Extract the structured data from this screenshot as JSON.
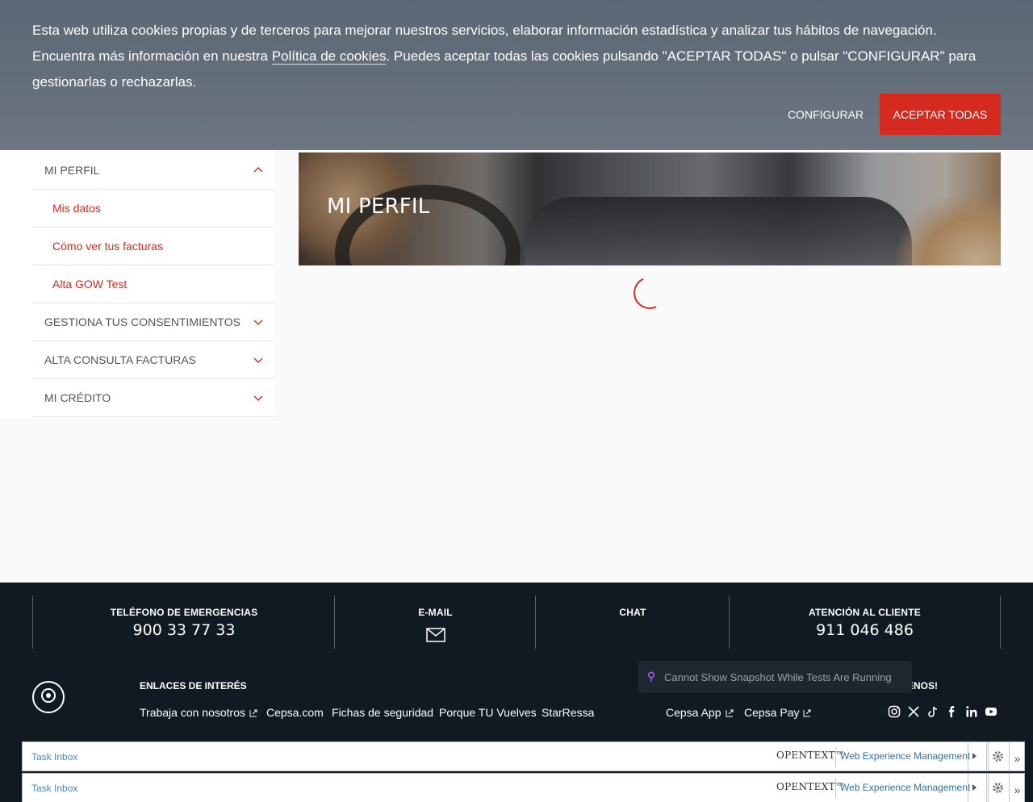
{
  "cookie_banner": {
    "text_before": "Esta web utiliza cookies propias y de terceros para mejorar nuestros servicios, elaborar información estadística y analizar tus hábitos de navegación. Encuentra más información en nuestra ",
    "policy_link": "Política de cookies",
    "text_after": ". Puedes aceptar todas las cookies pulsando \"ACEPTAR TODAS\" o pulsar \"CONFIGURAR\" para gestionarlas o rechazarlas.",
    "configure_label": "CONFIGURAR",
    "accept_label": "ACEPTAR TODAS",
    "accent_color": "#d42a1f"
  },
  "sidebar": {
    "items": [
      {
        "label": "MI PERFIL",
        "type": "parent",
        "expanded": true
      },
      {
        "label": "Mis datos",
        "type": "child"
      },
      {
        "label": "Cómo ver tus facturas",
        "type": "child"
      },
      {
        "label": "Alta GOW Test",
        "type": "child"
      },
      {
        "label": "GESTIONA TUS CONSENTIMIENTOS",
        "type": "parent",
        "expanded": false
      },
      {
        "label": "ALTA CONSULTA FACTURAS",
        "type": "parent",
        "expanded": false
      },
      {
        "label": "MI CRÉDITO",
        "type": "parent",
        "expanded": false
      }
    ]
  },
  "hero": {
    "title": "MI PERFIL"
  },
  "footer": {
    "contacts": [
      {
        "label": "TELÉFONO DE EMERGENCIAS",
        "value": "900 33 77 33"
      },
      {
        "label": "E-MAIL",
        "icon": "mail-icon"
      },
      {
        "label": "CHAT"
      },
      {
        "label": "ATENCIÓN AL CLIENTE",
        "value": "911 046 486"
      }
    ],
    "links_title": "ENLACES DE INTERÉS",
    "links": [
      "Trabaja con nosotros",
      "Cepsa.com",
      "Fichas de seguridad",
      "Porque TU Vuelves",
      "StarRessa",
      "Cepsa App",
      "Cepsa Pay"
    ],
    "follow_title_visible": "ENOS!",
    "social_icons": [
      "instagram-icon",
      "x-icon",
      "tiktok-icon",
      "facebook-icon",
      "linkedin-icon",
      "youtube-icon"
    ],
    "toast": "Cannot Show Snapshot While Tests Are Running"
  },
  "taskbars": [
    {
      "task_inbox": "Task Inbox",
      "brand": "OPENTEXT™",
      "product": "Web Experience Management"
    },
    {
      "task_inbox": "Task Inbox",
      "brand": "OPENTEXT™",
      "product": "Web Experience Management"
    }
  ]
}
